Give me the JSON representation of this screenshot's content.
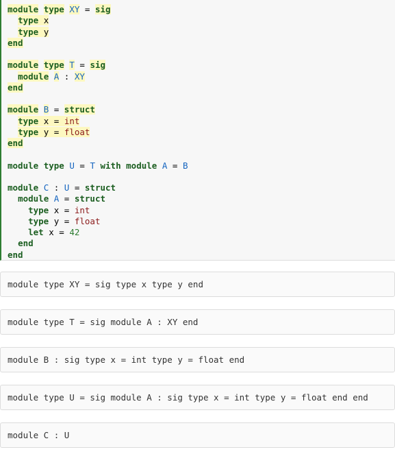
{
  "code_lines": [
    [
      {
        "t": "module",
        "c": "kw hl"
      },
      {
        "t": " ",
        "c": ""
      },
      {
        "t": "type",
        "c": "kw hl"
      },
      {
        "t": " ",
        "c": ""
      },
      {
        "t": "XY",
        "c": "mod hl"
      },
      {
        "t": " = ",
        "c": ""
      },
      {
        "t": "sig",
        "c": "kw hl"
      }
    ],
    [
      {
        "t": "  ",
        "c": ""
      },
      {
        "t": "type",
        "c": "kw hl"
      },
      {
        "t": " x",
        "c": "hl"
      }
    ],
    [
      {
        "t": "  ",
        "c": ""
      },
      {
        "t": "type",
        "c": "kw hl"
      },
      {
        "t": " y",
        "c": "hl"
      }
    ],
    [
      {
        "t": "end",
        "c": "kw hl"
      }
    ],
    [],
    [
      {
        "t": "module",
        "c": "kw hl"
      },
      {
        "t": " ",
        "c": ""
      },
      {
        "t": "type",
        "c": "kw hl"
      },
      {
        "t": " ",
        "c": ""
      },
      {
        "t": "T",
        "c": "mod hl"
      },
      {
        "t": " = ",
        "c": ""
      },
      {
        "t": "sig",
        "c": "kw hl"
      }
    ],
    [
      {
        "t": "  ",
        "c": ""
      },
      {
        "t": "module",
        "c": "kw hl"
      },
      {
        "t": " ",
        "c": ""
      },
      {
        "t": "A",
        "c": "mod hl"
      },
      {
        "t": " : ",
        "c": ""
      },
      {
        "t": "XY",
        "c": "mod hl"
      }
    ],
    [
      {
        "t": "end",
        "c": "kw hl"
      }
    ],
    [],
    [
      {
        "t": "module",
        "c": "kw hl"
      },
      {
        "t": " ",
        "c": ""
      },
      {
        "t": "B",
        "c": "mod hl"
      },
      {
        "t": " = ",
        "c": ""
      },
      {
        "t": "struct",
        "c": "kw hl"
      }
    ],
    [
      {
        "t": "  ",
        "c": ""
      },
      {
        "t": "type",
        "c": "kw hl"
      },
      {
        "t": " x = ",
        "c": "hl"
      },
      {
        "t": "int",
        "c": "ty hl"
      }
    ],
    [
      {
        "t": "  ",
        "c": ""
      },
      {
        "t": "type",
        "c": "kw hl"
      },
      {
        "t": " y = ",
        "c": "hl"
      },
      {
        "t": "float",
        "c": "ty hl"
      }
    ],
    [
      {
        "t": "end",
        "c": "kw hl"
      }
    ],
    [],
    [
      {
        "t": "module",
        "c": "kw"
      },
      {
        "t": " ",
        "c": ""
      },
      {
        "t": "type",
        "c": "kw"
      },
      {
        "t": " ",
        "c": ""
      },
      {
        "t": "U",
        "c": "mod"
      },
      {
        "t": " = ",
        "c": ""
      },
      {
        "t": "T",
        "c": "mod"
      },
      {
        "t": " ",
        "c": ""
      },
      {
        "t": "with",
        "c": "kw"
      },
      {
        "t": " ",
        "c": ""
      },
      {
        "t": "module",
        "c": "kw"
      },
      {
        "t": " ",
        "c": ""
      },
      {
        "t": "A",
        "c": "mod"
      },
      {
        "t": " = ",
        "c": ""
      },
      {
        "t": "B",
        "c": "mod"
      }
    ],
    [],
    [
      {
        "t": "module",
        "c": "kw"
      },
      {
        "t": " ",
        "c": ""
      },
      {
        "t": "C",
        "c": "mod"
      },
      {
        "t": " : ",
        "c": ""
      },
      {
        "t": "U",
        "c": "mod"
      },
      {
        "t": " = ",
        "c": ""
      },
      {
        "t": "struct",
        "c": "kw"
      }
    ],
    [
      {
        "t": "  ",
        "c": ""
      },
      {
        "t": "module",
        "c": "kw"
      },
      {
        "t": " ",
        "c": ""
      },
      {
        "t": "A",
        "c": "mod"
      },
      {
        "t": " = ",
        "c": ""
      },
      {
        "t": "struct",
        "c": "kw"
      }
    ],
    [
      {
        "t": "    ",
        "c": ""
      },
      {
        "t": "type",
        "c": "kw"
      },
      {
        "t": " x = ",
        "c": ""
      },
      {
        "t": "int",
        "c": "ty"
      }
    ],
    [
      {
        "t": "    ",
        "c": ""
      },
      {
        "t": "type",
        "c": "kw"
      },
      {
        "t": " y = ",
        "c": ""
      },
      {
        "t": "float",
        "c": "ty"
      }
    ],
    [
      {
        "t": "    ",
        "c": ""
      },
      {
        "t": "let",
        "c": "kw"
      },
      {
        "t": " x = ",
        "c": ""
      },
      {
        "t": "42",
        "c": "num"
      }
    ],
    [
      {
        "t": "  ",
        "c": ""
      },
      {
        "t": "end",
        "c": "kw"
      }
    ],
    [
      {
        "t": "end",
        "c": "kw"
      }
    ]
  ],
  "outputs": [
    "module type XY = sig type x type y end",
    "module type T = sig module A : XY end",
    "module B : sig type x = int type y = float end",
    "module type U = sig module A : sig type x = int type y = float end end",
    "module C : U"
  ],
  "colors": {
    "keyword": "#1b5e20",
    "module_name": "#1565c0",
    "type_name": "#8b1a1a",
    "number": "#2e7d32",
    "highlight": "#fdf8c0",
    "cell_border": "#2e7d32"
  }
}
